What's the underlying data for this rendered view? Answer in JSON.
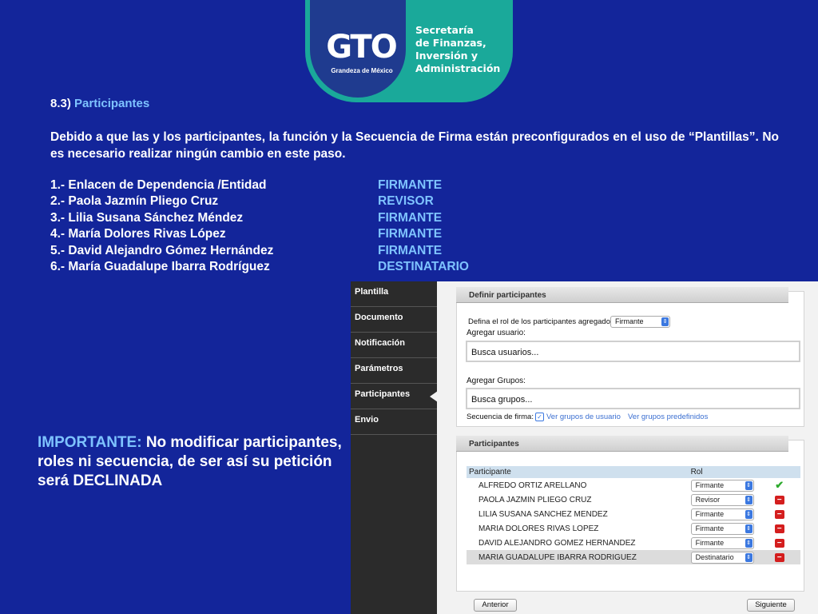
{
  "logo": {
    "mark": "GTO",
    "tagline": "Grandeza de México",
    "agency_lines": [
      "Secretaría",
      "de Finanzas,",
      "Inversión y",
      "Administración"
    ]
  },
  "section": {
    "number": "8.3)",
    "title": "Participantes"
  },
  "paragraph": "Debido a que las y los participantes, la función y la Secuencia de Firma están preconfigurados en el uso de “Plantillas”. No es necesario realizar ningún cambio en este paso.",
  "participants": [
    {
      "name": "1.- Enlacen de Dependencia /Entidad",
      "role": "FIRMANTE"
    },
    {
      "name": "2.- Paola Jazmín Pliego Cruz",
      "role": "REVISOR"
    },
    {
      "name": "3.- Lilia Susana Sánchez Méndez",
      "role": "FIRMANTE"
    },
    {
      "name": "4.- María Dolores Rivas López",
      "role": "FIRMANTE"
    },
    {
      "name": "5.- David Alejandro Gómez Hernández",
      "role": "FIRMANTE"
    },
    {
      "name": "6.- María Guadalupe Ibarra Rodríguez",
      "role": "DESTINATARIO"
    }
  ],
  "important": {
    "keyword": "IMPORTANTE:",
    "text": "No modificar participantes, roles ni secuencia, de ser así su petición será DECLINADA"
  },
  "app": {
    "nav": [
      {
        "label": "Plantilla"
      },
      {
        "label": "Documento"
      },
      {
        "label": "Notificación"
      },
      {
        "label": "Parámetros"
      },
      {
        "label": "Participantes"
      },
      {
        "label": "Envio"
      }
    ],
    "definir": {
      "header": "Definir participantes",
      "role_prompt": "Defina el rol de los participantes agregados:",
      "role_default": "Firmante",
      "add_user_label": "Agregar usuario:",
      "add_user_placeholder": "Busca usuarios...",
      "add_group_label": "Agregar Grupos:",
      "add_group_placeholder": "Busca grupos...",
      "sequence_label": "Secuencia de firma:",
      "link_user_groups": "Ver grupos de usuario",
      "link_predefined": "Ver grupos predefinidos"
    },
    "table": {
      "header": "Participantes",
      "col_participant": "Participante",
      "col_role": "Rol",
      "rows": [
        {
          "name": "ALFREDO ORTIZ ARELLANO",
          "role": "Firmante",
          "action": "check-icon"
        },
        {
          "name": "PAOLA JAZMIN PLIEGO CRUZ",
          "role": "Revisor",
          "action": "remove-icon"
        },
        {
          "name": "LILIA SUSANA SANCHEZ MENDEZ",
          "role": "Firmante",
          "action": "remove-icon"
        },
        {
          "name": "MARIA DOLORES RIVAS LOPEZ",
          "role": "Firmante",
          "action": "remove-icon"
        },
        {
          "name": "DAVID ALEJANDRO GOMEZ HERNANDEZ",
          "role": "Firmante",
          "action": "remove-icon"
        },
        {
          "name": "MARIA GUADALUPE IBARRA RODRIGUEZ",
          "role": "Destinatario",
          "action": "remove-icon"
        }
      ]
    },
    "btn_prev": "Anterior",
    "btn_next": "Siguiente"
  },
  "colors": {
    "background": "#13259a",
    "accent_text": "#7ec3ff",
    "logo_teal": "#1aa99a"
  }
}
